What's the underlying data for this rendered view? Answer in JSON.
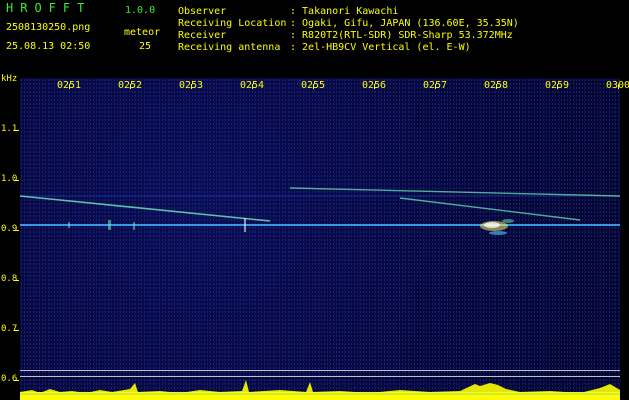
{
  "header": {
    "app_title": "HROFFT",
    "app_version": "1.0.0",
    "filename": "2508130250.png",
    "timestamp": "25.08.13 02:50",
    "meteor_label": "meteor",
    "meteor_count": "25",
    "observer_label": "Observer",
    "observer_value": ": Takanori Kawachi",
    "location_label": "Receiving Location",
    "location_value": ": Ogaki, Gifu, JAPAN (136.60E, 35.35N)",
    "receiver_label": "Receiver",
    "receiver_value": ": R820T2(RTL-SDR) SDR-Sharp 53.372MHz",
    "antenna_label": "Receiving antenna",
    "antenna_value": ": 2el-HB9CV Vertical (el. E-W)"
  },
  "y_axis": {
    "unit": "kHz",
    "ticks": [
      "1.1",
      "1.0",
      "0.9",
      "0.8",
      "0.7",
      "0.6"
    ]
  },
  "x_axis": {
    "ticks": [
      "0251",
      "0252",
      "0253",
      "0254",
      "0255",
      "0256",
      "0257",
      "0258",
      "0259",
      "0300"
    ]
  },
  "colors": {
    "label": "#ffff00",
    "title": "#33ee33",
    "background": "#050739",
    "carrier": "#3fb0ff",
    "meteor_trace": "#6ff0c0"
  }
}
